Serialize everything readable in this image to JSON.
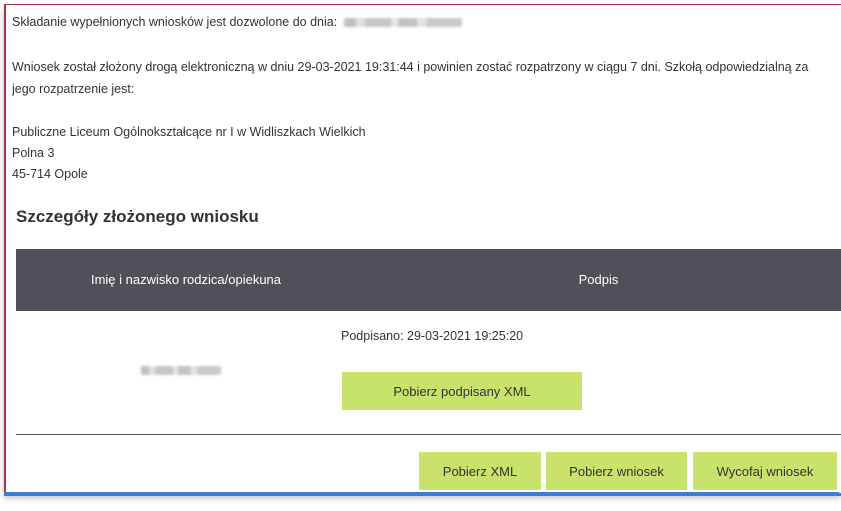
{
  "deadline": {
    "label": "Składanie wypełnionych wniosków jest dozwolone do dnia:"
  },
  "submission": {
    "info_line1": "Wniosek został złożony drogą elektroniczną w dniu 29-03-2021 19:31:44 i powinien zostać rozpatrzony w ciągu 7 dni. Szkołą odpowiedzialną za",
    "info_line2": "jego rozpatrzenie jest:"
  },
  "school": {
    "name": "Publiczne Liceum Ogólnokształcące nr I w Widliszkach Wielkich",
    "street": "Polna 3",
    "city": "45-714 Opole"
  },
  "details": {
    "title": "Szczegóły złożonego wniosku",
    "columns": [
      "Imię i nazwisko rodzica/opiekuna",
      "Podpis"
    ],
    "signed_text": "Podpisano: 29-03-2021 19:25:20",
    "download_signed_xml": "Pobierz podpisany XML"
  },
  "actions": {
    "download_xml": "Pobierz XML",
    "download_application": "Pobierz wniosek",
    "withdraw_application": "Wycofaj wniosek"
  },
  "colors": {
    "header_bg": "#505059",
    "button_bg": "#c8e36b",
    "frame_left": "#a8334a",
    "frame_bottom": "#3a7dd8"
  }
}
